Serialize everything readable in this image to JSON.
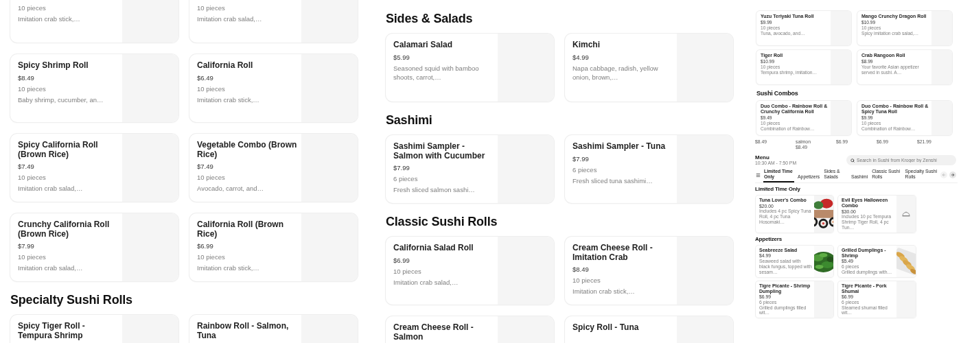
{
  "left": {
    "blocks": [
      {
        "kind": "cards",
        "cut": true,
        "cards": [
          {
            "pieces": "10 pieces",
            "description": "Imitation crab stick,…"
          },
          {
            "pieces": "10 pieces",
            "description": "Imitation crab salad,…"
          }
        ]
      },
      {
        "kind": "cards",
        "cut": false,
        "cards": [
          {
            "name": "Spicy Shrimp Roll",
            "price": "$8.49",
            "pieces": "10 pieces",
            "description": "Baby shrimp, cucumber, an…"
          },
          {
            "name": "California Roll",
            "price": "$6.49",
            "pieces": "10 pieces",
            "description": "Imitation crab stick,…"
          }
        ]
      },
      {
        "kind": "cards",
        "cut": false,
        "cards": [
          {
            "name": "Spicy California Roll (Brown Rice)",
            "price": "$7.49",
            "pieces": "10 pieces",
            "description": "Imitation crab salad,…"
          },
          {
            "name": "Vegetable Combo (Brown Rice)",
            "price": "$7.49",
            "pieces": "10 pieces",
            "description": "Avocado, carrot, and…"
          }
        ]
      },
      {
        "kind": "cards",
        "cut": false,
        "cards": [
          {
            "name": "Crunchy California Roll (Brown Rice)",
            "price": "$7.99",
            "pieces": "10 pieces",
            "description": "Imitation crab salad,…"
          },
          {
            "name": "California Roll (Brown Rice)",
            "price": "$6.99",
            "pieces": "10 pieces",
            "description": "Imitation crab stick,…"
          }
        ]
      },
      {
        "kind": "heading",
        "text": "Specialty Sushi Rolls"
      },
      {
        "kind": "cards",
        "cut": false,
        "cards": [
          {
            "name": "Spicy Tiger Roll - Tempura Shrimp"
          },
          {
            "name": "Rainbow Roll - Salmon, Tuna"
          }
        ]
      }
    ]
  },
  "middle": {
    "blocks": [
      {
        "kind": "heading",
        "text": "Sides & Salads"
      },
      {
        "kind": "cards",
        "cut": false,
        "cards": [
          {
            "name": "Calamari Salad",
            "price": "$5.99",
            "description": "Seasoned squid with bamboo shoots, carrot,…"
          },
          {
            "name": "Kimchi",
            "price": "$4.99",
            "description": "Napa cabbage, radish, yellow onion, brown,…"
          }
        ]
      },
      {
        "kind": "heading",
        "text": "Sashimi"
      },
      {
        "kind": "cards",
        "cut": false,
        "cards": [
          {
            "name": "Sashimi Sampler - Salmon with Cucumber",
            "price": "$7.99",
            "pieces": "6 pieces",
            "description": "Fresh sliced salmon sashi…"
          },
          {
            "name": "Sashimi Sampler - Tuna",
            "price": "$7.99",
            "pieces": "6 pieces",
            "description": "Fresh sliced tuna sashimi…"
          }
        ]
      },
      {
        "kind": "heading",
        "text": "Classic Sushi Rolls"
      },
      {
        "kind": "cards",
        "cut": false,
        "cards": [
          {
            "name": "California Salad Roll",
            "price": "$6.99",
            "pieces": "10 pieces",
            "description": "Imitation crab salad,…"
          },
          {
            "name": "Cream Cheese Roll - Imitation Crab",
            "price": "$8.49",
            "pieces": "10 pieces",
            "description": "Imitation crab stick,…"
          }
        ]
      },
      {
        "kind": "cards",
        "cut": false,
        "cards": [
          {
            "name": "Cream Cheese Roll - Salmon"
          },
          {
            "name": "Spicy Roll - Tuna"
          }
        ]
      }
    ]
  },
  "right": {
    "blocks": [
      {
        "kind": "cards",
        "cut": false,
        "cards": [
          {
            "name": "Yuzu Teriyaki Tuna Roll",
            "price": "$9.99",
            "pieces": "10 pieces",
            "description": "Tuna, avocado, and…"
          },
          {
            "name": "Mango Crunchy Dragon Roll",
            "price": "$10.99",
            "pieces": "10 pieces",
            "description": "Spicy imitation crab salad,…"
          }
        ]
      },
      {
        "kind": "cards",
        "cut": false,
        "cards": [
          {
            "name": "Tiger Roll",
            "price": "$10.99",
            "pieces": "10 pieces",
            "description": "Tempura shrimp, imitation…"
          },
          {
            "name": "Crab Rangoon Roll",
            "price": "$8.99",
            "description": "Your favorite Asian appetizer served in sushi. A…"
          }
        ]
      },
      {
        "kind": "heading",
        "text": "Sushi Combos"
      },
      {
        "kind": "cards",
        "cut": false,
        "cards": [
          {
            "name": "Duo Combo - Rainbow Roll & Crunchy California Roll",
            "price": "$9.49",
            "pieces": "10 pieces",
            "description": "Combination of Rainbow…"
          },
          {
            "name": "Duo Combo - Rainbow Roll & Spicy Tuna Roll",
            "price": "$9.99",
            "pieces": "10 pieces",
            "description": "Combination of Rainbow…"
          }
        ]
      }
    ],
    "price_strip": [
      {
        "lines": [
          "$8.49"
        ]
      },
      {
        "lines": [
          "salmon",
          "$8.49"
        ]
      },
      {
        "lines": [
          "$6.99"
        ]
      },
      {
        "lines": [
          "$6.99"
        ]
      },
      {
        "lines": [
          "$21.99"
        ]
      }
    ],
    "menu": {
      "title": "Menu",
      "hours": "10:30 AM - 7:50 PM",
      "search": {
        "placeholder": "Search in Sushi from Kroger by Zenshi"
      },
      "tabs": [
        {
          "label": "Limited Time Only",
          "selected": true
        },
        {
          "label": "Appetizers",
          "selected": false
        },
        {
          "label": "Sides & Salads",
          "selected": false
        },
        {
          "label": "Sashimi",
          "selected": false
        },
        {
          "label": "Classic Sushi Rolls",
          "selected": false
        },
        {
          "label": "Specialty Sushi Rolls",
          "selected": false
        }
      ],
      "sections": [
        {
          "heading": "Limited Time Only",
          "cards": [
            {
              "kind": "picture",
              "name": "Tuna Lover's Combo",
              "price": "$20.00",
              "description": "Includes 4 pc Spicy Tuna Roll, 4 pc Tuna Hosomaki…"
            },
            {
              "kind": "placeholder",
              "name": "Evil Eyes Halloween Combo",
              "price": "$30.00",
              "description": "Includes 10 pc Tempura Shrimp Tiger Roll, 4 pc Tun…"
            }
          ]
        },
        {
          "heading": "Appetizers",
          "cards": [
            {
              "kind": "picture",
              "name": "Seabreeze Salad",
              "price": "$4.99",
              "description": "Seaweed salad with black fungus, topped with sesam…"
            },
            {
              "kind": "picture",
              "name": "Grilled Dumplings - Shrimp",
              "price": "$5.49",
              "pieces": "6 pieces",
              "description": "Grilled dumplings with…"
            },
            {
              "kind": "plain",
              "name": "Tigre Picante - Shrimp Dumpling",
              "price": "$6.99",
              "pieces": "6 pieces",
              "description": "Grilled dumplings filled wit…"
            },
            {
              "kind": "plain",
              "name": "Tigre Picante - Pork Shumai",
              "price": "$6.99",
              "pieces": "6 pieces",
              "description": "Steamed shumai filled wit…"
            }
          ]
        }
      ]
    }
  }
}
